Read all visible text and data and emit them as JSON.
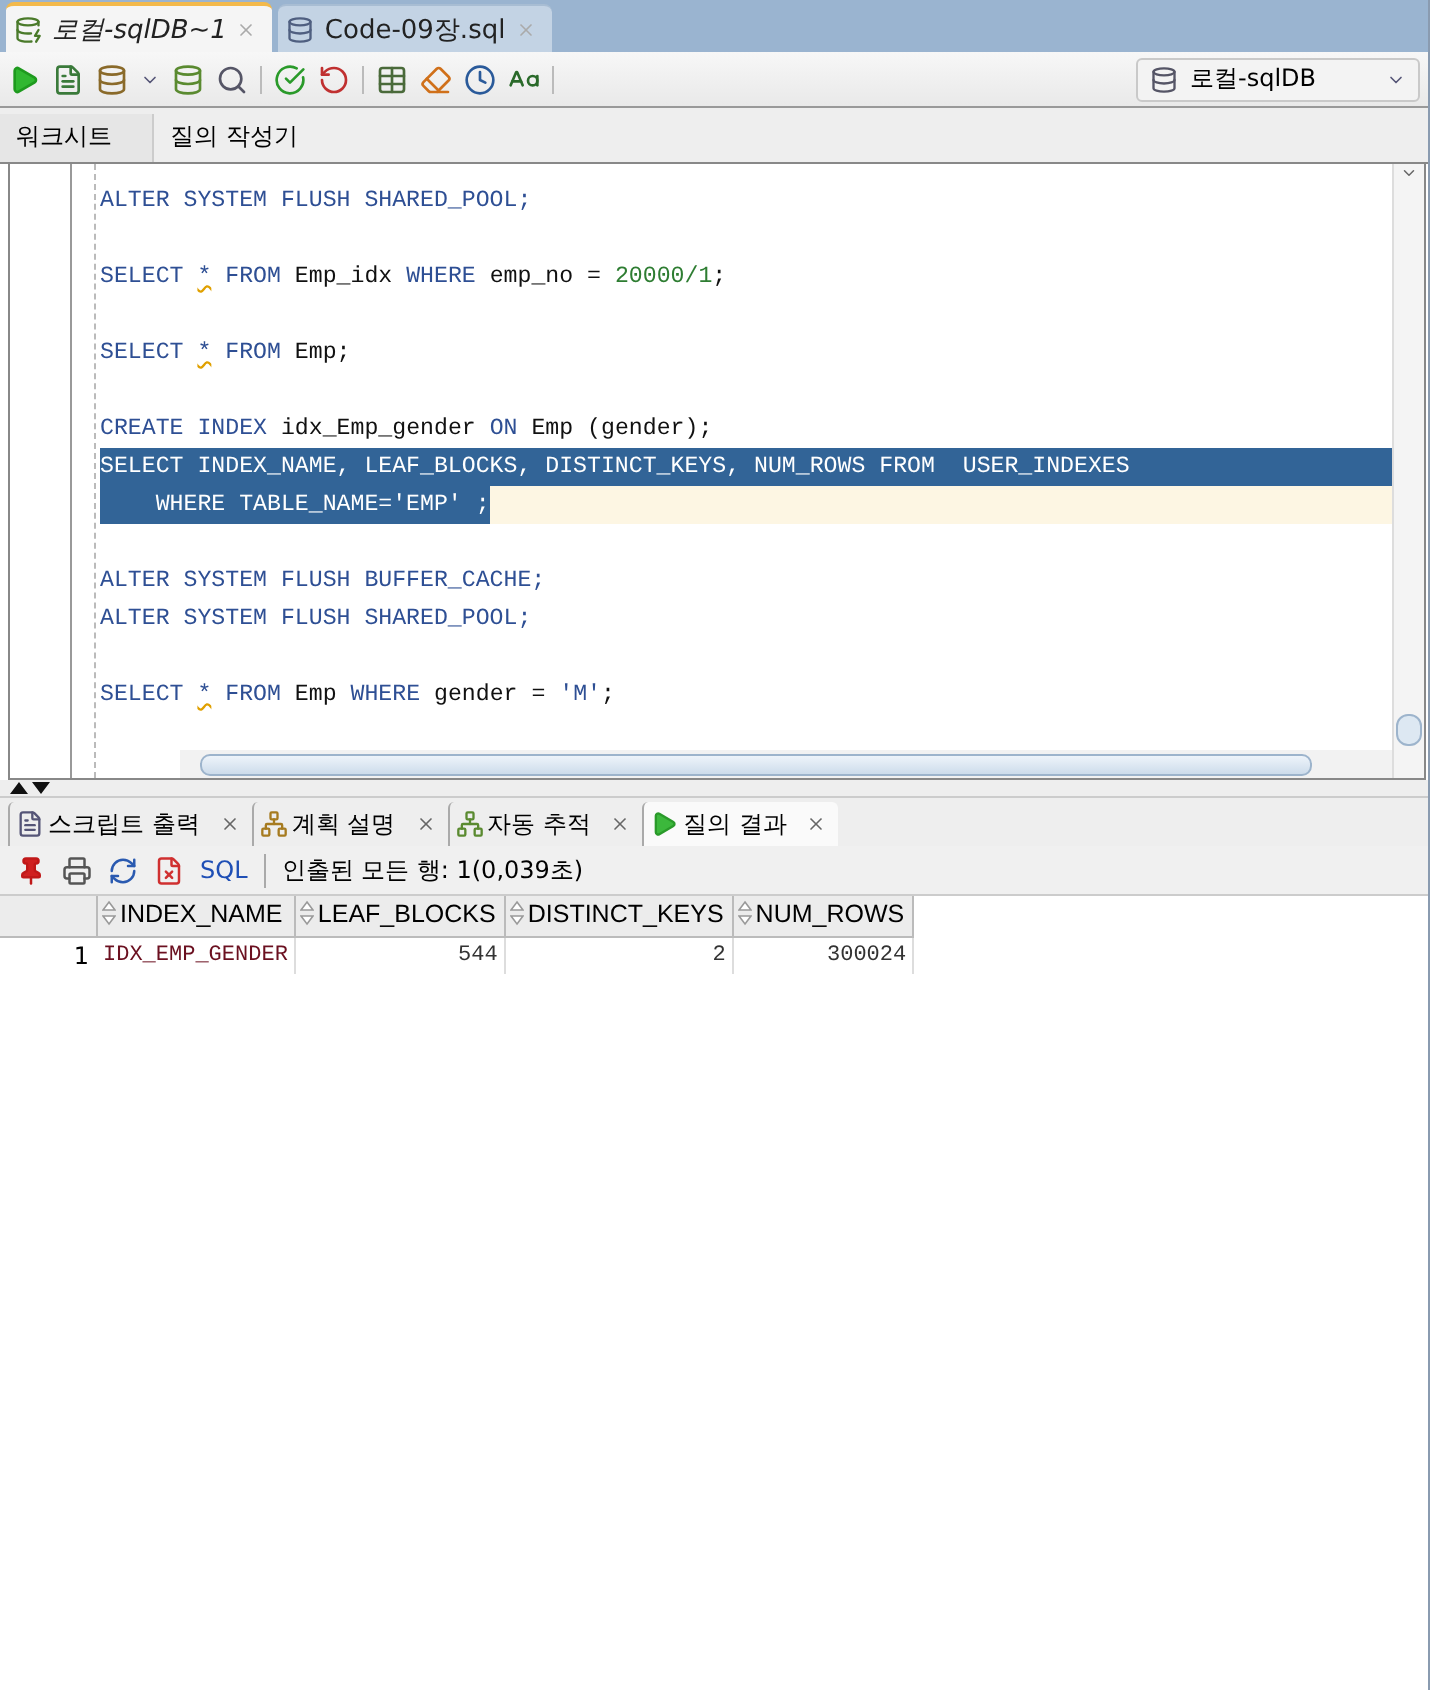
{
  "editor_tabs": [
    {
      "label": "로컬-sqlDB~1",
      "selected": true,
      "kind": "worksheet"
    },
    {
      "label": "Code-09장.sql",
      "selected": false,
      "kind": "file"
    }
  ],
  "connection": {
    "label": "로컬-sqlDB"
  },
  "sub_tabs": [
    {
      "label": "워크시트",
      "selected": true
    },
    {
      "label": "질의 작성기",
      "selected": false
    }
  ],
  "code_lines": [
    {
      "kind": "code",
      "selected": false,
      "tokens": [
        {
          "kind": "kw",
          "text": "ALTER SYSTEM FLUSH SHARED_POOL;"
        }
      ]
    },
    {
      "kind": "blank",
      "selected": false
    },
    {
      "kind": "code",
      "selected": false,
      "tokens": [
        {
          "kind": "kw",
          "text": "SELECT "
        },
        {
          "kind": "warn",
          "text": "*"
        },
        {
          "kind": "kw",
          "text": " FROM "
        },
        {
          "kind": "id",
          "text": "Emp_idx "
        },
        {
          "kind": "kw",
          "text": "WHERE "
        },
        {
          "kind": "id",
          "text": "emp_no = "
        },
        {
          "kind": "num",
          "text": "20000/1"
        },
        {
          "kind": "id",
          "text": ";"
        }
      ]
    },
    {
      "kind": "blank",
      "selected": false
    },
    {
      "kind": "code",
      "selected": false,
      "tokens": [
        {
          "kind": "kw",
          "text": "SELECT "
        },
        {
          "kind": "warn",
          "text": "*"
        },
        {
          "kind": "kw",
          "text": " FROM "
        },
        {
          "kind": "id",
          "text": "Emp;"
        }
      ]
    },
    {
      "kind": "blank",
      "selected": false
    },
    {
      "kind": "code",
      "selected": false,
      "tokens": [
        {
          "kind": "kw",
          "text": "CREATE INDEX "
        },
        {
          "kind": "id",
          "text": "idx_Emp_gender "
        },
        {
          "kind": "kw",
          "text": "ON "
        },
        {
          "kind": "id",
          "text": "Emp (gender);"
        }
      ]
    },
    {
      "kind": "code",
      "selected": true,
      "current": false,
      "tokens": [
        {
          "kind": "kw",
          "text": "SELECT INDEX_NAME, LEAF_BLOCKS, DISTINCT_KEYS, NUM_ROWS FROM  USER_INDEXES"
        }
      ]
    },
    {
      "kind": "code",
      "selected": true,
      "current": true,
      "tokens": [
        {
          "kind": "kw",
          "text": "    WHERE TABLE_NAME='EMP' ;"
        }
      ]
    },
    {
      "kind": "blank",
      "selected": false
    },
    {
      "kind": "code",
      "selected": false,
      "tokens": [
        {
          "kind": "kw",
          "text": "ALTER SYSTEM FLUSH BUFFER_CACHE;"
        }
      ]
    },
    {
      "kind": "code",
      "selected": false,
      "tokens": [
        {
          "kind": "kw",
          "text": "ALTER SYSTEM FLUSH SHARED_POOL;"
        }
      ]
    },
    {
      "kind": "blank",
      "selected": false
    },
    {
      "kind": "code",
      "selected": false,
      "tokens": [
        {
          "kind": "kw",
          "text": "SELECT "
        },
        {
          "kind": "warn",
          "text": "*"
        },
        {
          "kind": "kw",
          "text": " FROM "
        },
        {
          "kind": "id",
          "text": "Emp "
        },
        {
          "kind": "kw",
          "text": "WHERE "
        },
        {
          "kind": "id",
          "text": "gender = "
        },
        {
          "kind": "str",
          "text": "'M'"
        },
        {
          "kind": "id",
          "text": ";"
        }
      ]
    }
  ],
  "output_tabs": [
    {
      "label": "스크립트 출력",
      "selected": false,
      "kind": "script"
    },
    {
      "label": "계획 설명",
      "selected": false,
      "kind": "plan"
    },
    {
      "label": "자동 추적",
      "selected": false,
      "kind": "trace"
    },
    {
      "label": "질의 결과",
      "selected": true,
      "kind": "result"
    }
  ],
  "results_toolbar": {
    "sql_link": "SQL",
    "status": "인출된 모든 행: 1(0,039초)"
  },
  "table": {
    "columns": [
      {
        "label": "INDEX_NAME",
        "kind": "text"
      },
      {
        "label": "LEAF_BLOCKS",
        "kind": "number"
      },
      {
        "label": "DISTINCT_KEYS",
        "kind": "number"
      },
      {
        "label": "NUM_ROWS",
        "kind": "number"
      }
    ],
    "rows": [
      {
        "number": "1",
        "cells": [
          "IDX_EMP_GENDER",
          "544",
          "2",
          "300024"
        ]
      }
    ]
  }
}
